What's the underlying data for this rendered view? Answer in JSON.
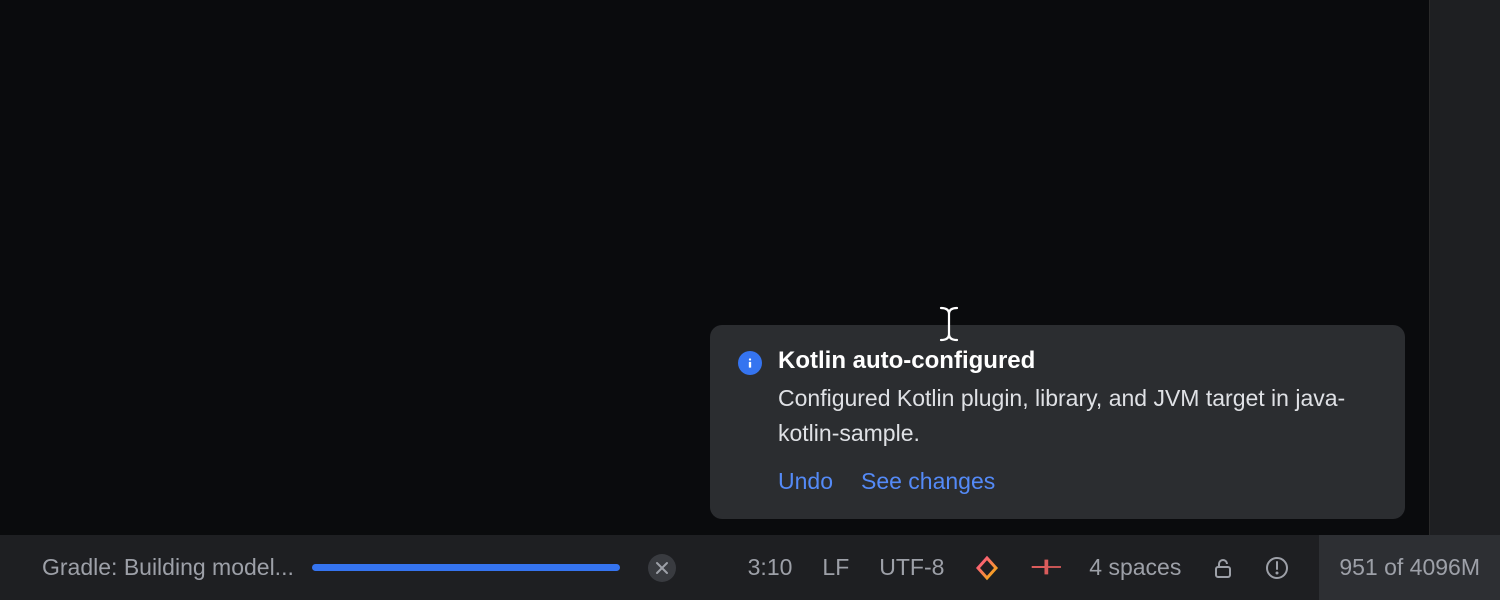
{
  "notification": {
    "title": "Kotlin auto-configured",
    "body": "Configured Kotlin plugin, library, and JVM target in java-kotlin-sample.",
    "actions": {
      "undo": "Undo",
      "see_changes": "See changes"
    }
  },
  "status_bar": {
    "task_label": "Gradle: Building model...",
    "cursor_position": "3:10",
    "line_separator": "LF",
    "encoding": "UTF-8",
    "indent": "4 spaces",
    "memory": "951 of 4096M"
  }
}
